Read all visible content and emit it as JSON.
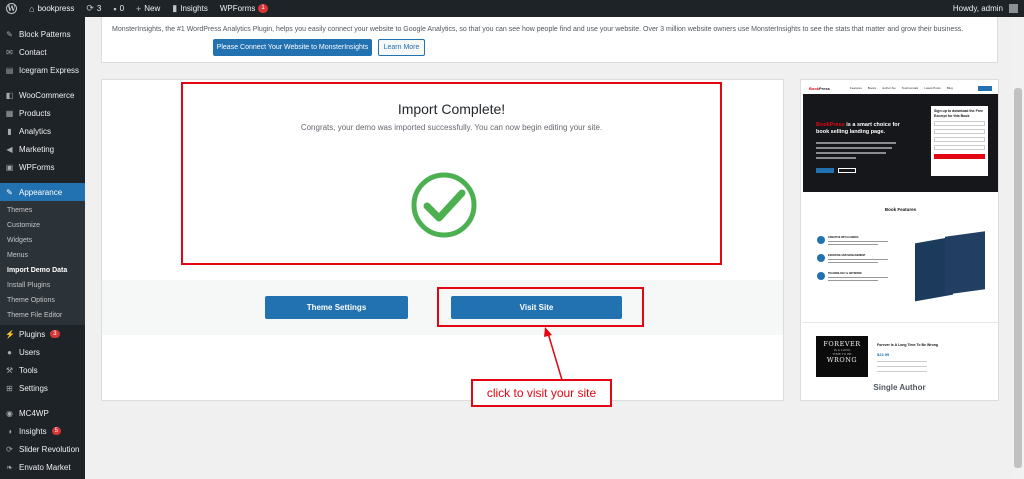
{
  "adminbar": {
    "site_name": "bookpress",
    "updates_count": "3",
    "comments_count": "0",
    "new_label": "New",
    "insights_label": "Insights",
    "wpforms_label": "WPForms",
    "wpforms_badge": "1",
    "howdy": "Howdy, admin"
  },
  "sidebar": {
    "items_top": [
      {
        "label": "Block Patterns",
        "icon": "pin-icon"
      },
      {
        "label": "Contact",
        "icon": "mail-icon"
      },
      {
        "label": "Icegram Express",
        "icon": "email-icon"
      }
    ],
    "items_mid": [
      {
        "label": "WooCommerce",
        "icon": "woo-icon"
      },
      {
        "label": "Products",
        "icon": "products-icon"
      },
      {
        "label": "Analytics",
        "icon": "analytics-icon"
      },
      {
        "label": "Marketing",
        "icon": "megaphone-icon"
      },
      {
        "label": "WPForms",
        "icon": "forms-icon"
      }
    ],
    "appearance_label": "Appearance",
    "submenu": [
      "Themes",
      "Customize",
      "Widgets",
      "Menus",
      "Import Demo Data",
      "Install Plugins",
      "Theme Options",
      "Theme File Editor"
    ],
    "current_submenu": "Import Demo Data",
    "plugins_label": "Plugins",
    "plugins_badge": "3",
    "users_label": "Users",
    "tools_label": "Tools",
    "settings_label": "Settings",
    "mc4wp_label": "MC4WP",
    "insights_label": "Insights",
    "insights_badge": "5",
    "slider_label": "Slider Revolution",
    "envato_label": "Envato Market"
  },
  "notice": {
    "text": "MonsterInsights, the #1 WordPress Analytics Plugin, helps you easily connect your website to Google Analytics, so that you can see how people find and use your website. Over 3 million website owners use MonsterInsights to see the stats that matter and grow their business.",
    "connect_button": "Please Connect Your Website to MonsterInsights",
    "learn_more_button": "Learn More"
  },
  "import": {
    "title": "Import Complete!",
    "message": "Congrats, your demo was imported successfully. You can now begin editing your site."
  },
  "actions": {
    "theme_settings": "Theme Settings",
    "visit_site": "Visit Site"
  },
  "annotation": {
    "callout": "click to visit your site"
  },
  "preview": {
    "caption": "Single Author",
    "logo_prefix": "Book",
    "logo_suffix": "Press",
    "nav_items": [
      "Features",
      "Books",
      "Author bio",
      "Testimonials",
      "Latest Posts",
      "Blog"
    ],
    "hero_brand": "BookPress",
    "hero_rest": " is a smart choice for book selling landing page.",
    "form_title": "Sign up to download the Free Excerpt for this Book",
    "features_title": "Book Features",
    "features": [
      "CREATIVE WITH A MEDIA",
      "EXERCISE AND MANAGEMENT",
      "TECHNOLOGY & ARTWORK"
    ],
    "book_cover_word_1": "FOREVER",
    "book_cover_small_1": "IS A LONG",
    "book_cover_small_2": "TIME TO BE",
    "book_cover_word_2": "WRONG",
    "product_title": "Forever Is A Long Time To Be Wrong",
    "product_price": "$22.99"
  },
  "colors": {
    "wp_blue": "#2271b1",
    "wp_dark": "#1d2327",
    "annotation_red": "#e30613",
    "success_green": "#4caf50"
  }
}
